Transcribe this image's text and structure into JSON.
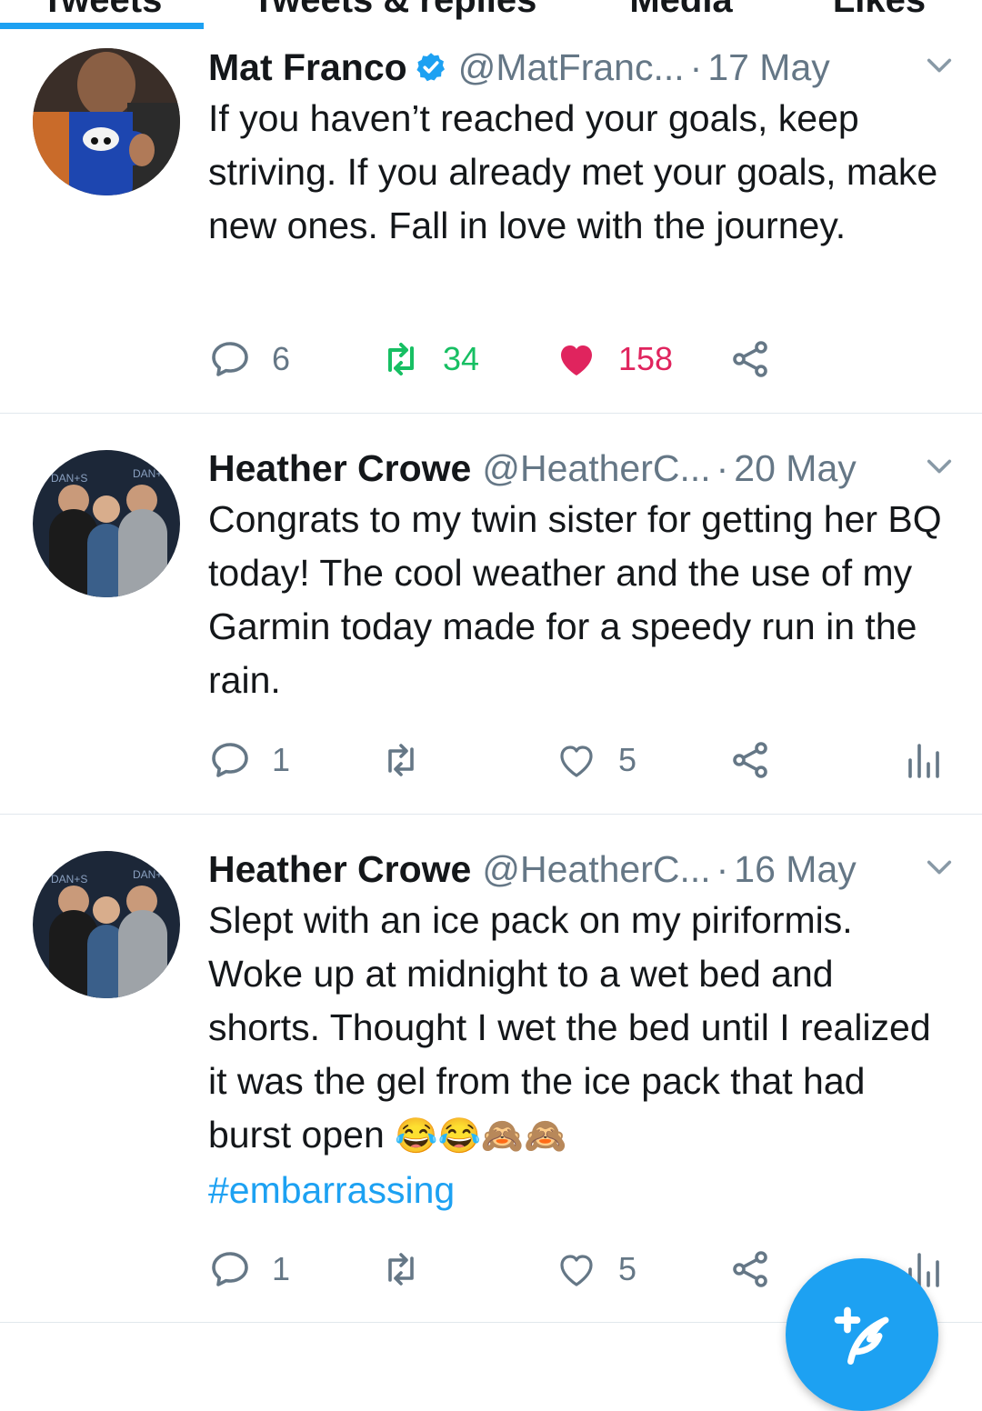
{
  "tabs": [
    {
      "label": "Tweets"
    },
    {
      "label": "Tweets & replies"
    },
    {
      "label": "Media"
    },
    {
      "label": "Likes"
    }
  ],
  "tweets": [
    {
      "name": "Mat Franco",
      "verified": true,
      "handle": "@MatFranc...",
      "date": "17 May",
      "text": "If you haven’t reached your goals, keep striving. If you already met your goals, make new ones. Fall in love with the journey.",
      "replies": "6",
      "retweets": "34",
      "likes": "158",
      "retweeted": true,
      "liked": true
    },
    {
      "name": "Heather Crowe",
      "verified": false,
      "handle": "@HeatherC...",
      "date": "20 May",
      "text": "Congrats to my twin sister for getting her BQ today! The cool weather and the use of my Garmin today made for a speedy run in the rain.",
      "replies": "1",
      "retweets": "",
      "likes": "5"
    },
    {
      "name": "Heather Crowe",
      "verified": false,
      "handle": "@HeatherC...",
      "date": "16 May",
      "text": "Slept with an ice pack on my piriformis. Woke up at midnight to a wet bed and shorts. Thought I wet the bed until I realized it was the gel from the ice pack that had burst open",
      "emojis": "😂😂🙈🙈",
      "hashtag": "#embarrassing",
      "replies": "1",
      "retweets": "",
      "likes": "5"
    }
  ],
  "separator": "·",
  "colors": {
    "accent": "#1da1f2",
    "retweet": "#17bf63",
    "like": "#e0245e",
    "secondary_text": "#657786"
  },
  "icons": [
    "reply-icon",
    "retweet-icon",
    "like-icon",
    "share-icon",
    "analytics-icon",
    "chevron-down-icon",
    "verified-badge-icon",
    "compose-tweet-icon"
  ]
}
